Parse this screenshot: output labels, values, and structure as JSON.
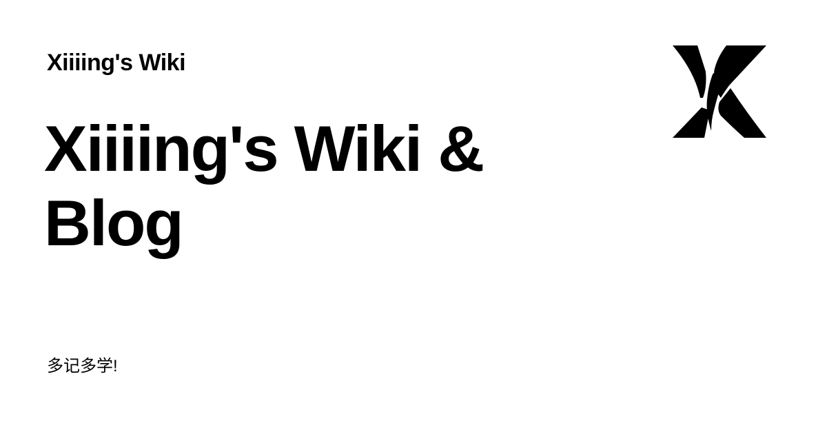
{
  "header": {
    "site_name": "Xiiiing's Wiki"
  },
  "main": {
    "title": "Xiiiing's Wiki & Blog",
    "tagline": "多记多学!"
  },
  "logo": {
    "icon": "x-logo-icon",
    "letter": "X",
    "color": "#000000"
  }
}
